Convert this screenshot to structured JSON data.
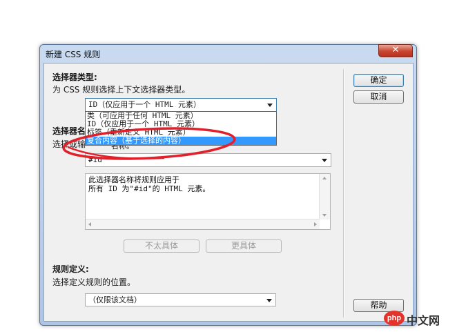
{
  "window": {
    "title": "新建 CSS 规则",
    "close_label": "✕"
  },
  "selector_type": {
    "heading": "选择器类型:",
    "description": "为 CSS 规则选择上下文选择器类型。",
    "selected": "ID（仅应用于一个 HTML 元素）",
    "options": [
      "类（可应用于任何 HTML 元素）",
      "ID（仅应用于一个 HTML 元素）",
      "标签（重新定义 HTML 元素）",
      "复合内容（基于选择的内容）"
    ],
    "highlighted_index": 3
  },
  "selector_name": {
    "heading_partial": "选择器名",
    "description_partial_left": "选择或输",
    "description_partial_right": "名称。",
    "value": "#id",
    "info_text": "此选择器名称将规则应用于\n所有 ID 为\"#id\"的 HTML 元素。"
  },
  "buttons": {
    "ok": "确定",
    "cancel": "取消",
    "less_specific": "不太具体",
    "more_specific": "更具体",
    "help": "帮助"
  },
  "rule_definition": {
    "heading": "规则定义:",
    "description": "选择定义规则的位置。",
    "selected": "（仅限该文档）"
  },
  "watermark": {
    "logo": "php",
    "text": "中文网"
  },
  "colors": {
    "annotation": "#e0202a",
    "highlight": "#3399ff",
    "frame": "#aec6e6"
  }
}
